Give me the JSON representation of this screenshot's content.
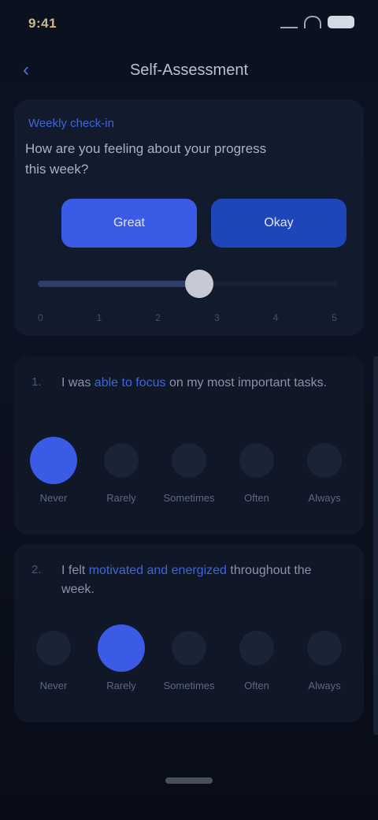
{
  "status_bar": {
    "time": "9:41",
    "battery_label": "100"
  },
  "header": {
    "back_icon": "chevron-left-icon",
    "title": "Self-Assessment"
  },
  "intro": {
    "eyebrow": "Weekly check-in",
    "text": "How are you feeling about your progress this week?",
    "primary_label": "Great",
    "secondary_label": "Okay",
    "slider_value": 0.54,
    "scale": [
      "0",
      "1",
      "2",
      "3",
      "4",
      "5"
    ]
  },
  "questions": [
    {
      "number": "1.",
      "text_before": "I was",
      "text_highlight": "able to focus",
      "text_after": "on my most important tasks.",
      "options": [
        "Never",
        "Rarely",
        "Sometimes",
        "Often",
        "Always"
      ],
      "selected": 0
    },
    {
      "number": "2.",
      "text_before": "I felt",
      "text_highlight": "motivated and energized",
      "text_after": "throughout the week.",
      "options": [
        "Never",
        "Rarely",
        "Sometimes",
        "Often",
        "Always"
      ],
      "selected": 1
    }
  ],
  "colors": {
    "accent": "#3b5be6",
    "accent_dark": "#1f46b8",
    "background": "#0b0f1c",
    "card": "#121a2e"
  }
}
